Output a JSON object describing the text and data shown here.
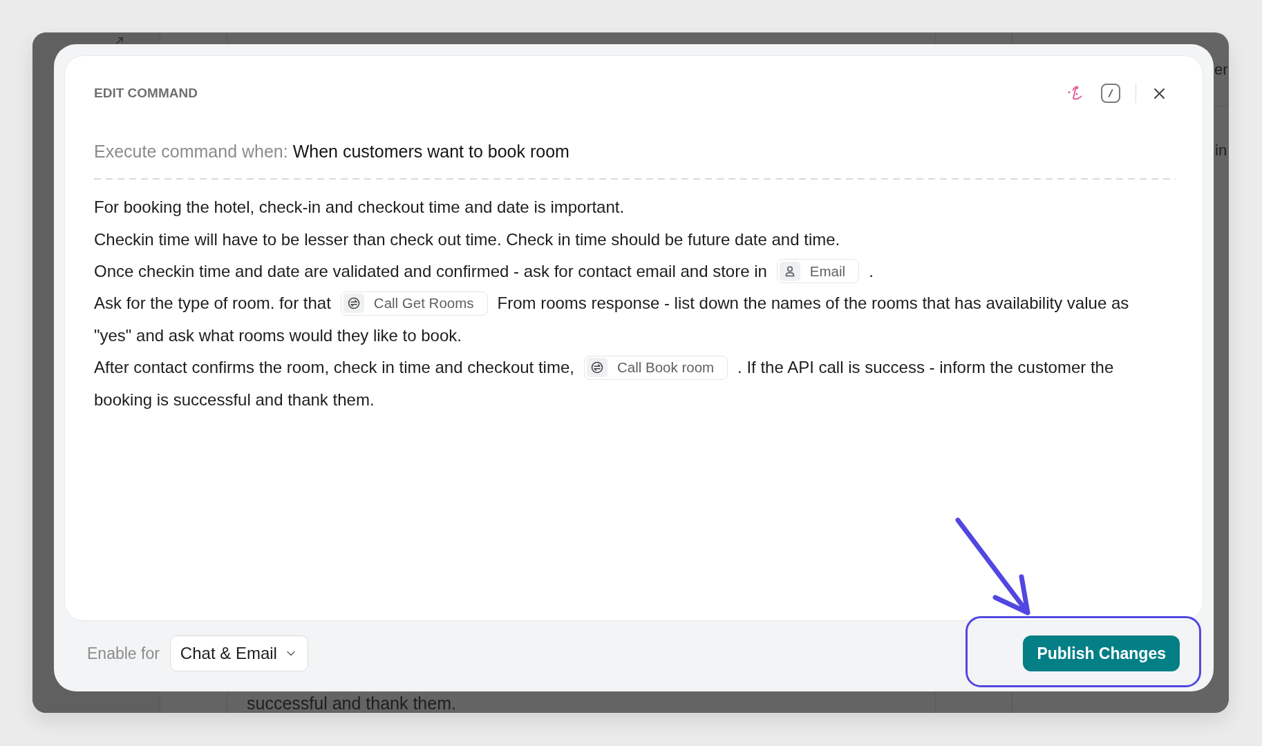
{
  "dialog": {
    "title": "EDIT COMMAND",
    "trigger": {
      "label": "Execute command when:",
      "value": "When customers want to book room"
    },
    "instructions": [
      {
        "segments": [
          {
            "kind": "text",
            "text": "For booking the hotel, check-in and checkout time and date is important."
          }
        ]
      },
      {
        "segments": [
          {
            "kind": "text",
            "text": "Checkin time will have to be lesser than check out time. Check in time should be future date and time."
          }
        ]
      },
      {
        "segments": [
          {
            "kind": "text",
            "text": "Once checkin time and date are validated and confirmed - ask for contact email and store in"
          },
          {
            "kind": "attribute",
            "text": "Email"
          },
          {
            "kind": "text",
            "text": "."
          }
        ]
      },
      {
        "segments": [
          {
            "kind": "text",
            "text": "Ask for the type of room. for that"
          },
          {
            "kind": "action",
            "text": "Call Get Rooms"
          },
          {
            "kind": "text",
            "text": "From rooms response - list down the names of the rooms that has availability value as"
          }
        ]
      },
      {
        "segments": [
          {
            "kind": "text",
            "text": "\"yes\" and ask what rooms would they like to book."
          }
        ]
      },
      {
        "segments": [
          {
            "kind": "text",
            "text": "After contact confirms the room, check in time and checkout time,"
          },
          {
            "kind": "action",
            "text": "Call Book room"
          },
          {
            "kind": "text",
            "text": ". If the API call is success - inform the customer the"
          }
        ]
      },
      {
        "segments": [
          {
            "kind": "text",
            "text": "booking is successful and thank them."
          }
        ]
      }
    ],
    "footer": {
      "enable_for_label": "Enable for",
      "channel_select": "Chat & Email",
      "publish_button": "Publish Changes"
    }
  },
  "background_page": {
    "fragments": [
      "er",
      "in"
    ],
    "text": "successful and thank them."
  }
}
